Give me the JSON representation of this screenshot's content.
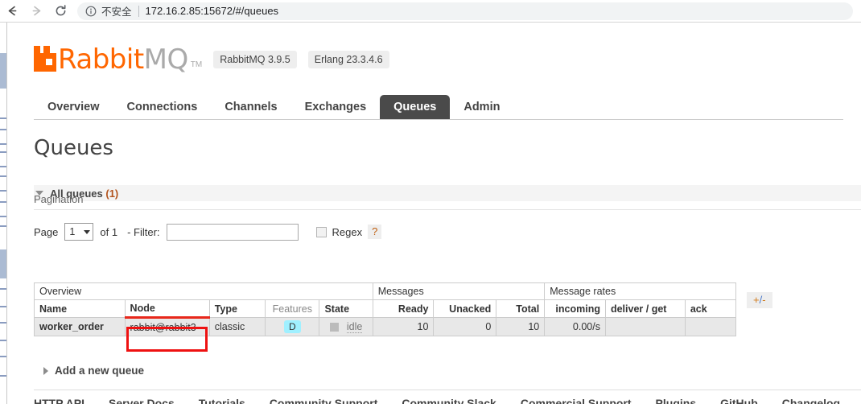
{
  "browser": {
    "back_icon": "back-arrow-icon",
    "forward_icon": "forward-arrow-icon",
    "reload_icon": "reload-icon",
    "info_icon": "info-circle-icon",
    "security_text": "不安全",
    "url_host": "172.16.2.85:15672",
    "url_path": "/#/queues",
    "url_full": "172.16.2.85:15672/#/queues"
  },
  "brand": {
    "name_primary": "Rabbit",
    "name_secondary": "MQ",
    "trademark": "TM",
    "logo_icon": "rabbitmq-logo-icon",
    "version_badge": "RabbitMQ 3.9.5",
    "erlang_badge": "Erlang 23.3.4.6",
    "accent_color": "#ff6600",
    "secondary_color": "#aaaaaa"
  },
  "nav": {
    "tabs": [
      {
        "label": "Overview",
        "active": false
      },
      {
        "label": "Connections",
        "active": false
      },
      {
        "label": "Channels",
        "active": false
      },
      {
        "label": "Exchanges",
        "active": false
      },
      {
        "label": "Queues",
        "active": true
      },
      {
        "label": "Admin",
        "active": false
      }
    ]
  },
  "page": {
    "title": "Queues",
    "all_queues_label": "All queues",
    "all_queues_count": "(1)"
  },
  "pagination": {
    "heading": "Pagination",
    "page_label": "Page",
    "page_value": "1",
    "of_label": "of 1",
    "filter_label": "- Filter:",
    "filter_value": "",
    "filter_placeholder": "",
    "regex_label": "Regex",
    "regex_checked": false,
    "help_label": "?"
  },
  "table": {
    "groups": [
      {
        "label": "Overview",
        "span": 5
      },
      {
        "label": "Messages",
        "span": 3
      },
      {
        "label": "Message rates",
        "span": 3
      }
    ],
    "columns": [
      {
        "label": "Name",
        "align": "left",
        "sorted": false,
        "dim": false
      },
      {
        "label": "Node",
        "align": "left",
        "sorted": true,
        "dim": false
      },
      {
        "label": "Type",
        "align": "left",
        "sorted": false,
        "dim": false
      },
      {
        "label": "Features",
        "align": "center",
        "sorted": false,
        "dim": true
      },
      {
        "label": "State",
        "align": "left",
        "sorted": false,
        "dim": false
      },
      {
        "label": "Ready",
        "align": "right",
        "sorted": false,
        "dim": false
      },
      {
        "label": "Unacked",
        "align": "right",
        "sorted": false,
        "dim": false
      },
      {
        "label": "Total",
        "align": "right",
        "sorted": false,
        "dim": false
      },
      {
        "label": "incoming",
        "align": "right",
        "sorted": false,
        "dim": false
      },
      {
        "label": "deliver / get",
        "align": "left",
        "sorted": false,
        "dim": false
      },
      {
        "label": "ack",
        "align": "left",
        "sorted": false,
        "dim": false
      }
    ],
    "rows": [
      {
        "name": "worker_order",
        "node": "rabbit@rabbit3",
        "type": "classic",
        "features": "D",
        "state": "idle",
        "ready": "10",
        "unacked": "0",
        "total": "10",
        "incoming": "0.00/s",
        "deliver_get": "",
        "ack": ""
      }
    ],
    "toggle_columns_label": "+/-",
    "sort_indicator_color": "#e8271b"
  },
  "annotation": {
    "target": "rabbit@rabbit3",
    "color": "#ee1111"
  },
  "add_queue": {
    "label": "Add a new queue"
  },
  "footer": {
    "links": [
      "HTTP API",
      "Server Docs",
      "Tutorials",
      "Community Support",
      "Community Slack",
      "Commercial Support",
      "Plugins",
      "GitHub",
      "Changelog"
    ]
  }
}
